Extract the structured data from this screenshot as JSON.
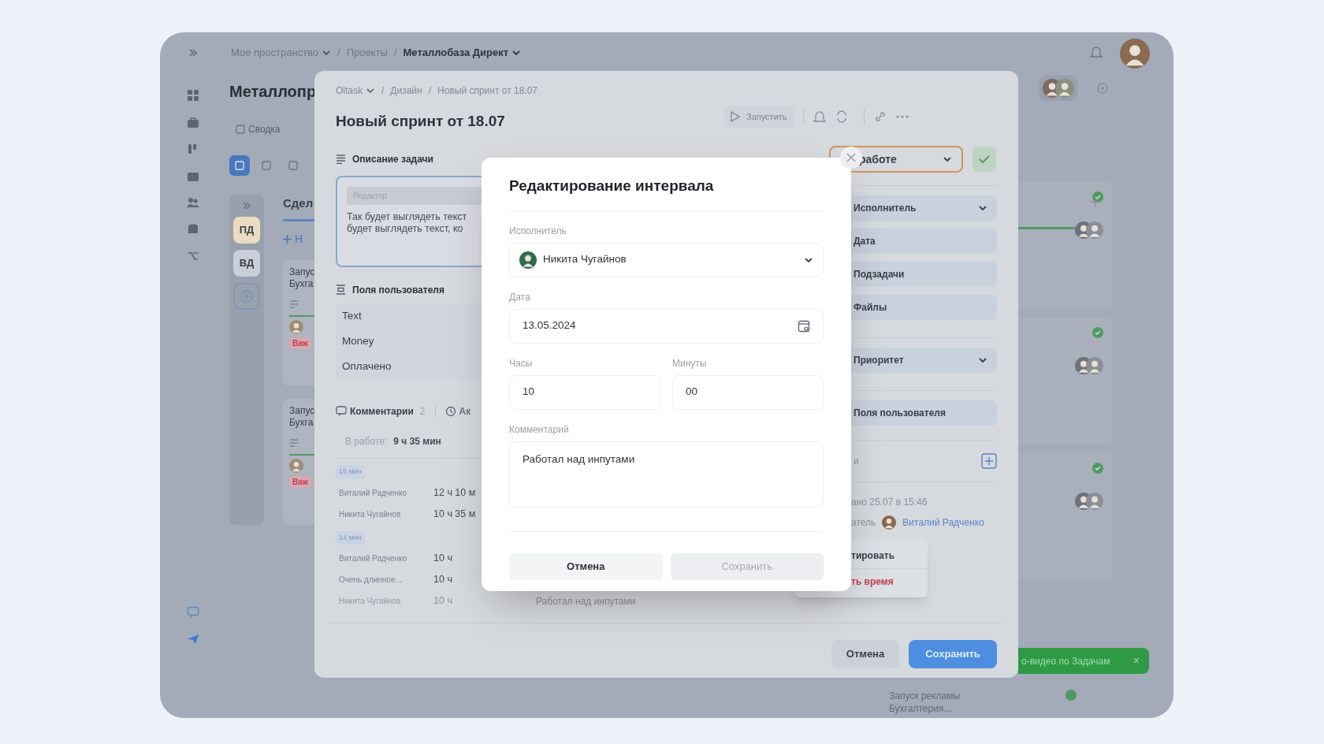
{
  "app": {
    "breadcrumb_separator": "/",
    "breadcrumb": [
      {
        "label": "Мое пространство",
        "dropdown": true,
        "current": false
      },
      {
        "label": "Проекты",
        "dropdown": false,
        "current": false
      },
      {
        "label": "Металлобаза Директ",
        "dropdown": true,
        "current": true
      }
    ],
    "project_title": "Металлопр",
    "tabs": [
      {
        "label": "Сводка",
        "selected": false
      }
    ],
    "view_buttons": [
      {
        "selected": true
      },
      {
        "selected": false
      },
      {
        "selected": false
      }
    ],
    "column_chips": [
      {
        "label": "ПД",
        "color": "#e9dcc0"
      },
      {
        "label": "ВД",
        "color": "#c9ced8"
      }
    ],
    "column_title": "Сдел",
    "add_label": "Н",
    "cards": [
      {
        "lines": [
          "Запус",
          "Бухга"
        ],
        "tag": "Важ"
      },
      {
        "lines": [
          "Запус",
          "Бухга"
        ],
        "tag": "Важ"
      }
    ],
    "right_cards": [
      {
        "done": true
      },
      {
        "done": true
      },
      {
        "done": true
      }
    ],
    "bottom_card": {
      "lines": [
        "Запуск рекламы",
        "Бухгалтерия..."
      ],
      "done": true
    },
    "toast": {
      "text": "о-видео по Задачам",
      "close": "×"
    }
  },
  "task": {
    "breadcrumb_separator": "/",
    "breadcrumb": [
      {
        "label": "Oltask",
        "dropdown": true
      },
      {
        "label": "Дизайн",
        "dropdown": false
      },
      {
        "label": "Новый спринт от 18.07",
        "dropdown": false
      }
    ],
    "title": "Новый спринт от 18.07",
    "run_label": "Запустить",
    "description_heading": "Описание задачи",
    "editor_label": "Редактор",
    "editor_lines": [
      "Так будет выглядеть текст",
      "будет выглядеть текст, ко"
    ],
    "custom_fields_heading": "Поля пользователя",
    "custom_fields": [
      "Text",
      "Money",
      "Оплачено"
    ],
    "activity_tabs": [
      {
        "label": "Комментарии",
        "count": "2",
        "selected": true
      },
      {
        "label": "Ак",
        "selected": false
      }
    ],
    "work_label": "В работе:",
    "work_value": "9 ч 35 мин",
    "time_groups": [
      {
        "badge": "15 мин",
        "rows": [
          {
            "name": "Виталий Радченко",
            "value": "12 ч 10 м",
            "faded": false
          },
          {
            "name": "Никита Чугайнов",
            "value": "10 ч 35 м",
            "faded": false
          }
        ]
      },
      {
        "badge": "14 мин",
        "rows": [
          {
            "name": "Виталий Радченко",
            "value": "10 ч",
            "faded": false
          },
          {
            "name": "Очень длинное...",
            "value": "10 ч",
            "faded": false
          },
          {
            "name": "Никита Чугайнов",
            "value": "10 ч",
            "comment": "Работал над инпутами",
            "faded": true
          }
        ]
      }
    ],
    "status": "работе",
    "sections": [
      {
        "label": "Исполнитель",
        "expandable": true
      },
      {
        "label": "Дата",
        "expandable": false
      },
      {
        "label": "Подзадачи",
        "expandable": false
      },
      {
        "label": "Файлы",
        "expandable": false
      },
      {
        "label": "Приоритет",
        "expandable": true
      },
      {
        "label": "Поля пользователя",
        "expandable": false
      }
    ],
    "links_label": "и",
    "created": "ано 25.07 в 15:46",
    "author_label": "атель",
    "author_name": "Виталий Радченко",
    "menu": [
      {
        "label": "тировать",
        "danger": false
      },
      {
        "label": "ть время",
        "danger": true
      }
    ],
    "buttons": {
      "cancel": "Отмена",
      "save": "Сохранить"
    }
  },
  "modal": {
    "title": "Редактирование интервала",
    "assignee_label": "Исполнитель",
    "assignee": "Никита Чугайнов",
    "date_label": "Дата",
    "date": "13.05.2024",
    "hours_label": "Часы",
    "hours": "10",
    "minutes_label": "Минуты",
    "minutes": "00",
    "comment_label": "Комментарий",
    "comment": "Работал над инпутами",
    "cancel": "Отмена",
    "save": "Сохранить",
    "save_disabled": true
  }
}
